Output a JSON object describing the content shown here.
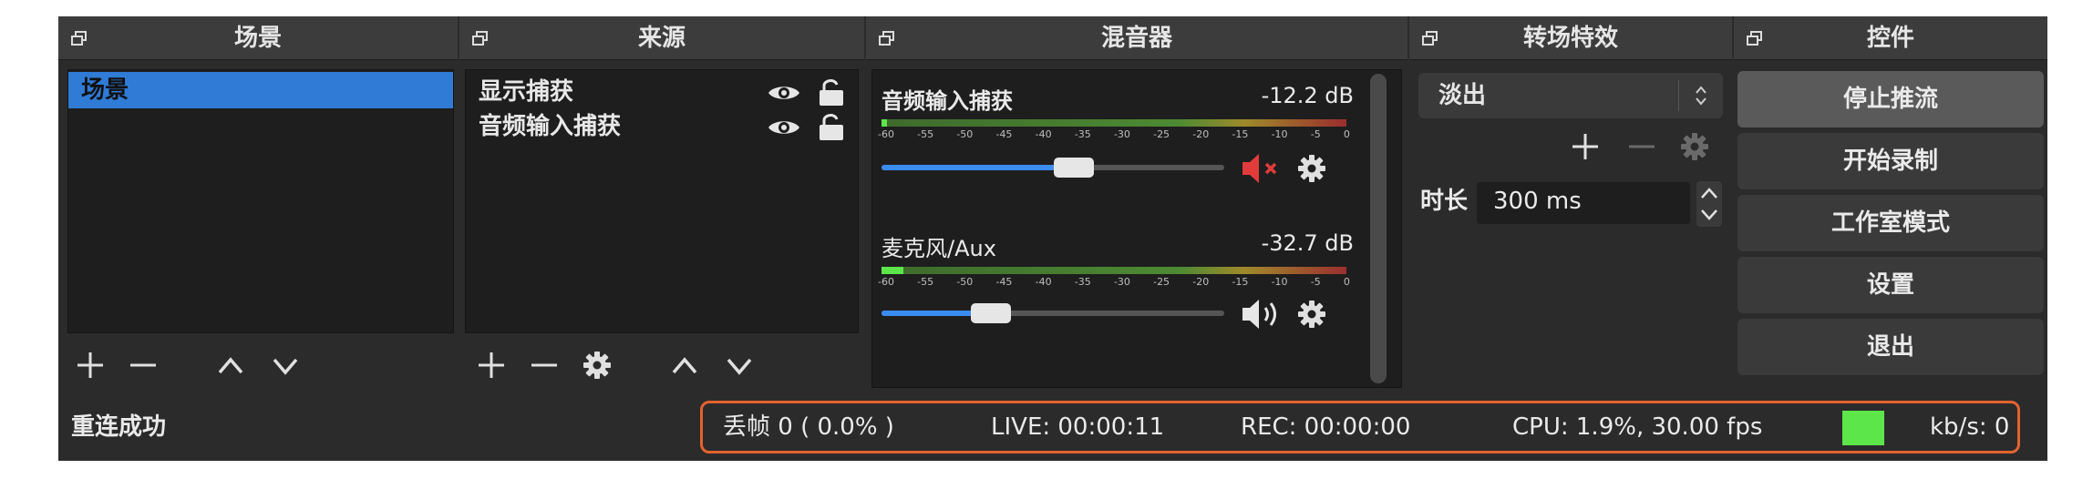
{
  "docks": {
    "scenes": {
      "title": "场景",
      "items": [
        {
          "label": "场景",
          "selected": true
        }
      ]
    },
    "sources": {
      "title": "来源",
      "items": [
        {
          "label": "显示捕获"
        },
        {
          "label": "音频输入捕获"
        }
      ]
    },
    "mixer": {
      "title": "混音器",
      "channels": [
        {
          "name": "音频输入捕获",
          "db": "-12.2 dB",
          "volume": 0.56,
          "muted": true
        },
        {
          "name": "麦克风/Aux",
          "db": "-32.7 dB",
          "volume": 0.32,
          "muted": false
        }
      ],
      "ticks": [
        "-60",
        "-55",
        "-50",
        "-45",
        "-40",
        "-35",
        "-30",
        "-25",
        "-20",
        "-15",
        "-10",
        "-5",
        "0"
      ]
    },
    "transitions": {
      "title": "转场特效",
      "selected": "淡出",
      "duration_label": "时长",
      "duration_value": "300 ms"
    },
    "controls": {
      "title": "控件",
      "buttons": [
        "停止推流",
        "开始录制",
        "工作室模式",
        "设置",
        "退出"
      ]
    }
  },
  "status": {
    "message": "重连成功",
    "dropped": "丢帧 0 ( 0.0% )",
    "live": "LIVE: 00:00:11",
    "rec": "REC: 00:00:00",
    "cpu": "CPU: 1.9%, 30.00 fps",
    "kbps": "kb/s: 0",
    "indicator_color": "#5ce64a"
  },
  "colors": {
    "selection": "#2f7bd6",
    "accent": "#3b8cf0",
    "highlight": "#e3632f",
    "mute": "#e23b3b"
  }
}
